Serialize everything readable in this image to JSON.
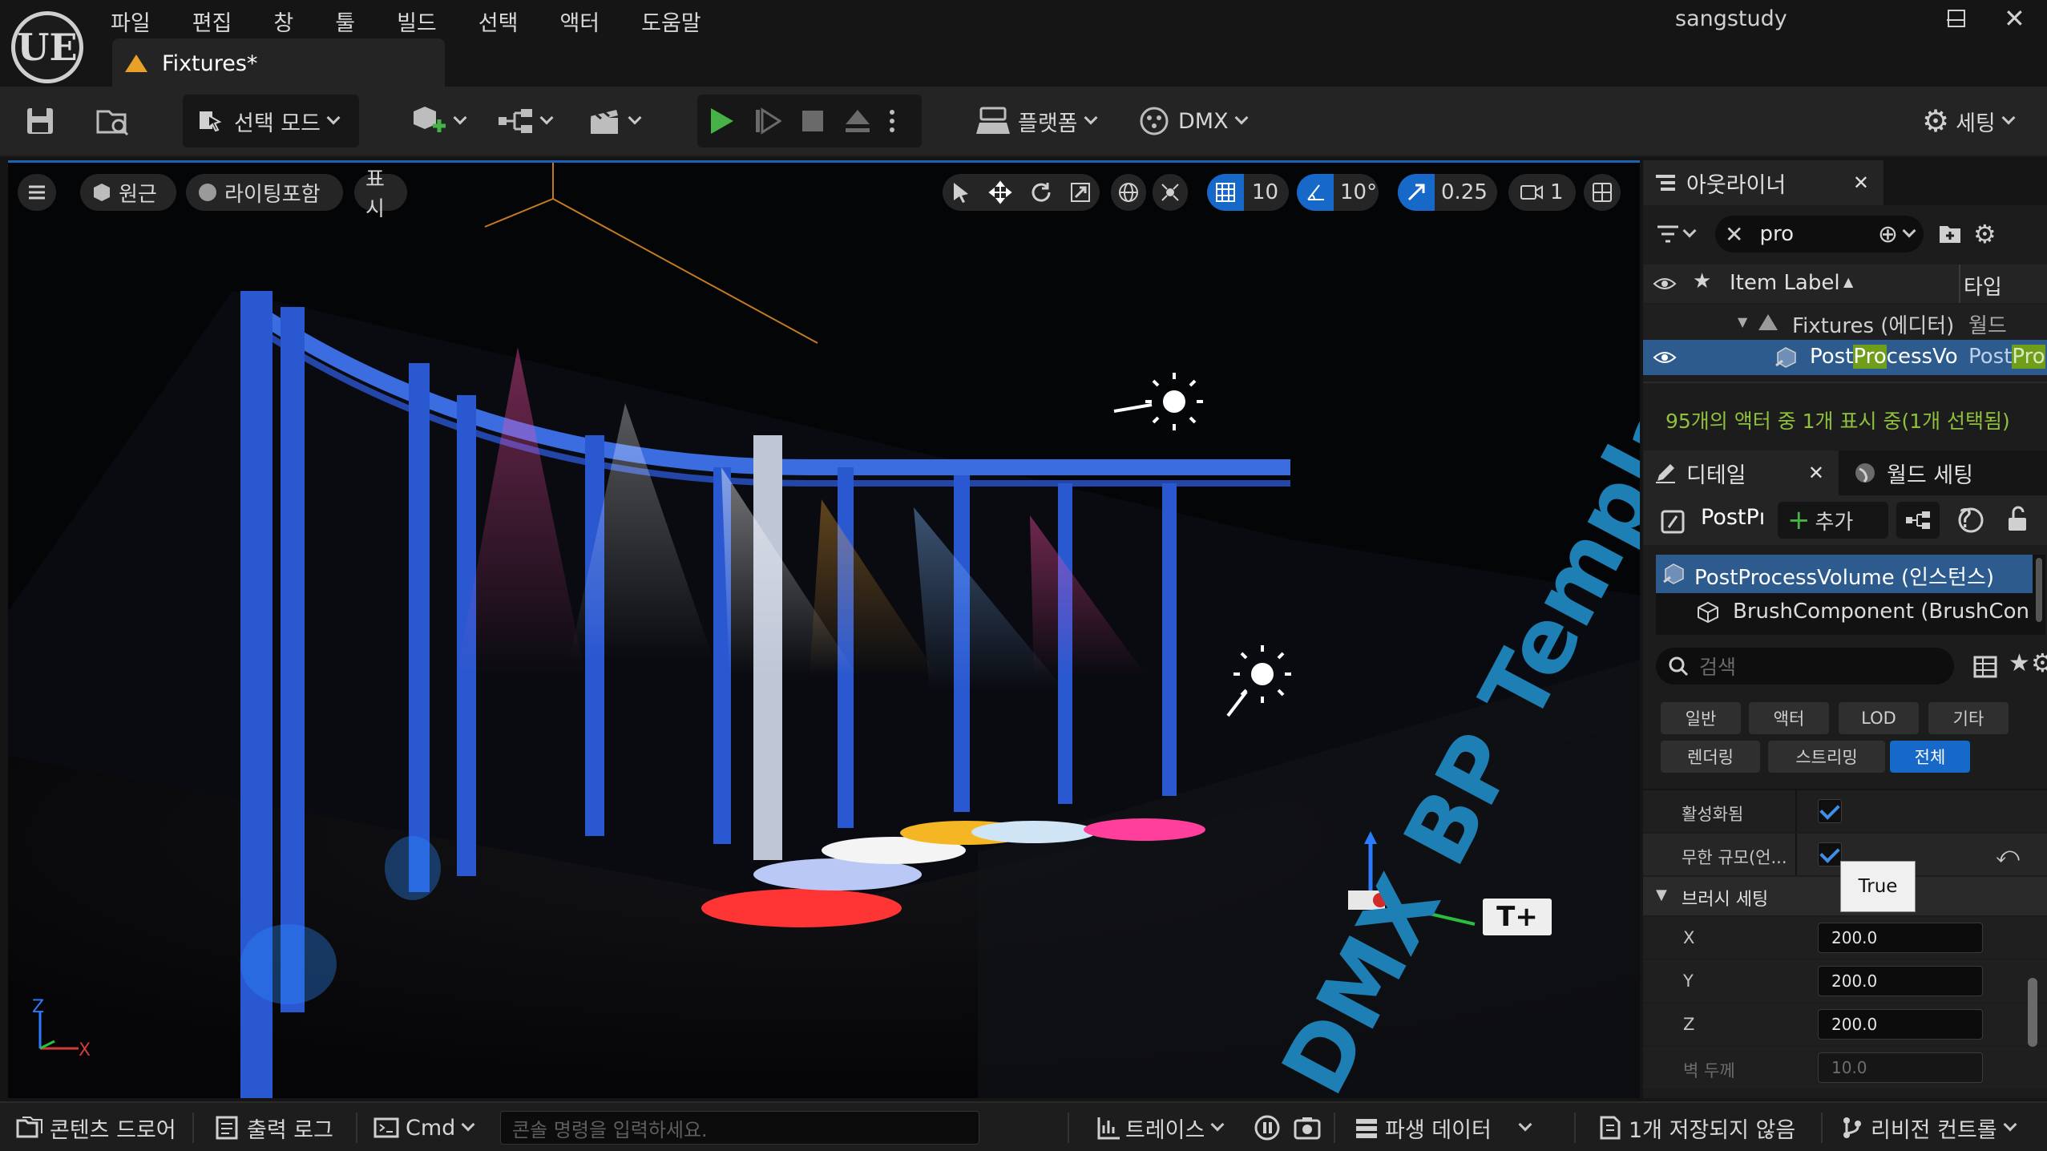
{
  "app": {
    "logo": "UE",
    "menu": [
      "파일",
      "편집",
      "창",
      "툴",
      "빌드",
      "선택",
      "액터",
      "도움말"
    ],
    "document_tab": "Fixtures*",
    "username": "sangstudy",
    "window_controls": {
      "minimize": "—",
      "maximize": "☐",
      "close": "✕"
    }
  },
  "toolbar": {
    "select_mode": "선택 모드",
    "platform": "플랫폼",
    "dmx": "DMX",
    "settings": "세팅"
  },
  "viewport": {
    "perspective": "원근",
    "lighting": "라이팅포함",
    "show": "표시",
    "grid_snap": "10",
    "rotation_snap": "10°",
    "scale_snap": "0.25",
    "camera_speed": "1",
    "axis_z": "Z",
    "axis_x": "X",
    "floor_text": "DMX BP Template",
    "text_actor_label": "T+"
  },
  "outliner": {
    "title": "아웃라이너",
    "search_value": "pro",
    "col_label": "Item Label",
    "col_type": "타입",
    "rows": [
      {
        "label": "Fixtures (에디터)",
        "type": "월드"
      },
      {
        "label_pre": "Post",
        "label_hl": "Pro",
        "label_post": "cessVo",
        "type_pre": "Post",
        "type_hl": "Pro"
      }
    ],
    "status": "95개의 액터 중 1개 표시 중(1개 선택됨)"
  },
  "details": {
    "tab_details": "디테일",
    "tab_world": "월드 세팅",
    "actor_name": "PostPı",
    "add_label": "추가",
    "components": [
      "PostProcessVolume (인스턴스)",
      "BrushComponent (BrushCon"
    ],
    "search_placeholder": "검색",
    "filters": [
      "일반",
      "액터",
      "LOD",
      "기타",
      "렌더링",
      "스트리밍",
      "전체"
    ],
    "props": {
      "enabled_label": "활성화됨",
      "unbound_label": "무한 규모(언...",
      "tooltip": "True",
      "section": "브러시 세팅",
      "x_label": "X",
      "x_value": "200.0",
      "y_label": "Y",
      "y_value": "200.0",
      "z_label": "Z",
      "z_value": "200.0",
      "wall_label": "벽 두께",
      "wall_value": "10.0"
    }
  },
  "statusbar": {
    "content_drawer": "콘텐츠 드로어",
    "output_log": "출력 로그",
    "cmd": "Cmd",
    "console_placeholder": "콘솔 명령을 입력하세요.",
    "trace": "트레이스",
    "derived_data": "파생 데이터",
    "unsaved": "1개 저장되지 않음",
    "revision_control": "리비전 컨트롤"
  },
  "colors": {
    "accent_blue": "#1668c9",
    "highlight_green": "#6f9f1a",
    "status_green": "#8fc03d",
    "warning_orange": "#e8a028",
    "play_green": "#47b347"
  }
}
